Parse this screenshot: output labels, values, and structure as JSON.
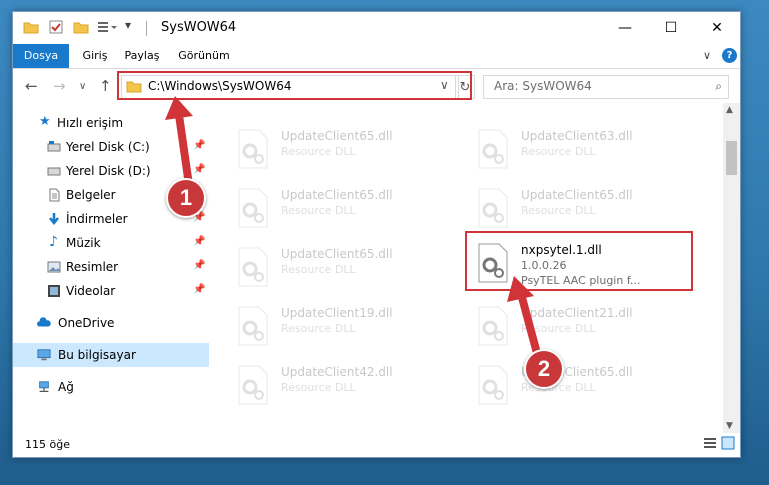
{
  "window": {
    "title": "SysWOW64",
    "controls": {
      "minimize": "—",
      "maximize": "☐",
      "close": "✕"
    }
  },
  "ribbon": {
    "tabs": [
      "Dosya",
      "Giriş",
      "Paylaş",
      "Görünüm"
    ],
    "active_tab": "Dosya",
    "collapse_glyph": "∨",
    "help_glyph": "?"
  },
  "address": {
    "path": "C:\\Windows\\SysWOW64",
    "dropdown_glyph": "∨",
    "refresh_glyph": "↻"
  },
  "search": {
    "placeholder": "Ara: SysWOW64",
    "icon": "search-icon",
    "glyph": "⌕"
  },
  "nav_buttons": {
    "back": "←",
    "forward": "→",
    "recent": "∨",
    "up": "↑"
  },
  "sidebar": {
    "items": [
      {
        "label": "Hızlı erişim",
        "icon": "star-icon",
        "pinned": false
      },
      {
        "label": "Yerel Disk (C:)",
        "icon": "drive-icon",
        "pinned": true
      },
      {
        "label": "Yerel Disk (D:)",
        "icon": "drive-icon",
        "pinned": true
      },
      {
        "label": "Belgeler",
        "icon": "documents-icon",
        "pinned": true
      },
      {
        "label": "İndirmeler",
        "icon": "download-icon",
        "pinned": true
      },
      {
        "label": "Müzik",
        "icon": "music-icon",
        "pinned": true
      },
      {
        "label": "Resimler",
        "icon": "pictures-icon",
        "pinned": true
      },
      {
        "label": "Videolar",
        "icon": "videos-icon",
        "pinned": true
      },
      {
        "label": "OneDrive",
        "icon": "cloud-icon",
        "pinned": false
      },
      {
        "label": "Bu bilgisayar",
        "icon": "computer-icon",
        "pinned": false,
        "selected": true
      },
      {
        "label": "Ağ",
        "icon": "network-icon",
        "pinned": false
      }
    ],
    "pin_glyph": "📌"
  },
  "files": [
    {
      "name": "UpdateClient65.dll",
      "type": "Resource DLL",
      "faded": true
    },
    {
      "name": "UpdateClient63.dll",
      "type": "Resource DLL",
      "faded": true
    },
    {
      "name": "UpdateClient65.dll",
      "type": "Resource DLL",
      "faded": true
    },
    {
      "name": "UpdateClient65.dll",
      "type": "Resource DLL",
      "faded": true
    },
    {
      "name": "UpdateClient65.dll",
      "type": "Resource DLL",
      "faded": true
    },
    {
      "name": "nxpsytel.1.dll",
      "version": "1.0.0.26",
      "type": "PsyTEL AAC plugin f...",
      "faded": false,
      "highlighted": true
    },
    {
      "name": "UpdateClient19.dll",
      "type": "Resource DLL",
      "faded": true
    },
    {
      "name": "UpdateClient21.dll",
      "type": "Resource DLL",
      "faded": true
    },
    {
      "name": "UpdateClient42.dll",
      "type": "Resource DLL",
      "faded": true
    },
    {
      "name": "UpdateClient65.dll",
      "type": "Resource DLL",
      "faded": true
    }
  ],
  "status": {
    "count": "115 öğe"
  },
  "annotations": {
    "step1": "1",
    "step2": "2",
    "color": "#d13438"
  },
  "colors": {
    "accent": "#1979ca",
    "highlight": "#d13438",
    "selection": "#cce8ff"
  }
}
